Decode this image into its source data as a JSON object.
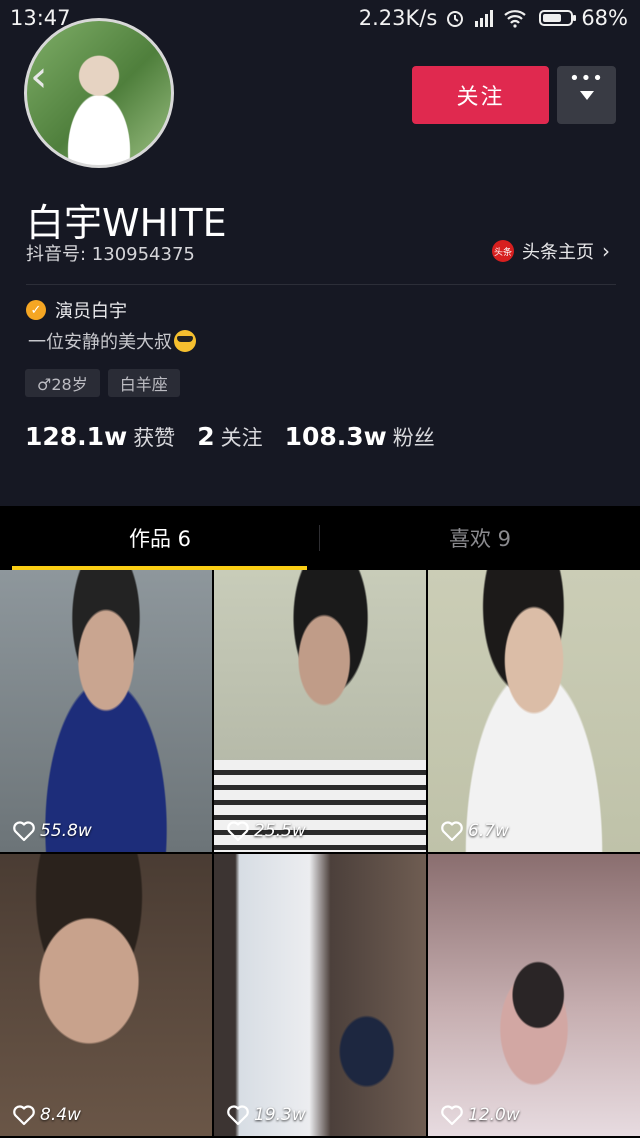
{
  "status_bar": {
    "time": "13:47",
    "net_speed": "2.23K/s",
    "battery": "68%",
    "battery_level": 0.68
  },
  "profile": {
    "follow_label": "关注",
    "nickname": "白宇WHITE",
    "douyin_id": "抖音号: 130954375",
    "toutiao_logo_text": "头条",
    "toutiao_label": "头条主页",
    "verified_label": "演员白宇",
    "bio": "一位安静的美大叔",
    "tags": [
      {
        "icon": "male-icon",
        "text": "♂28岁"
      },
      {
        "text": "白羊座"
      }
    ],
    "stats": [
      {
        "value": "128.1w",
        "label": "获赞"
      },
      {
        "value": "2",
        "label": "关注"
      },
      {
        "value": "108.3w",
        "label": "粉丝"
      }
    ]
  },
  "tabs": [
    {
      "label": "作品 6",
      "active": true
    },
    {
      "label": "喜欢 9",
      "active": false
    }
  ],
  "videos": [
    {
      "likes": "55.8w"
    },
    {
      "likes": "25.5w"
    },
    {
      "likes": "6.7w"
    },
    {
      "likes": "8.4w"
    },
    {
      "likes": "19.3w"
    },
    {
      "likes": "12.0w"
    }
  ],
  "colors": {
    "background": "#161823",
    "follow_button": "#e0294f",
    "tab_indicator": "#face15"
  }
}
